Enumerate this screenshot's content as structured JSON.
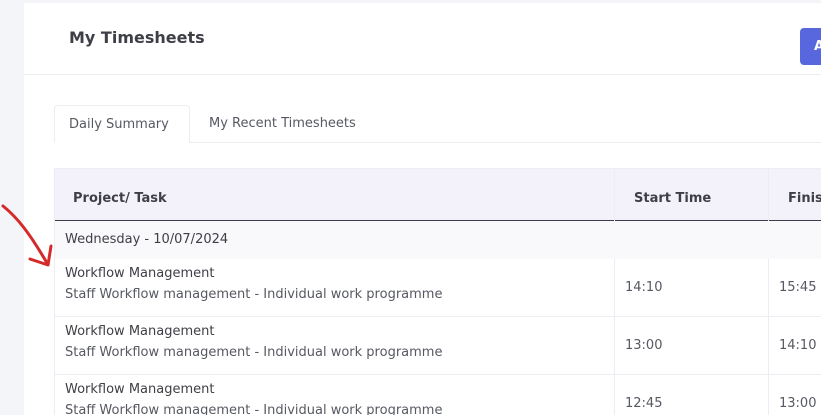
{
  "header": {
    "title": "My Timesheets",
    "add_button_label": "A"
  },
  "tabs": [
    {
      "label": "Daily Summary",
      "active": true
    },
    {
      "label": "My Recent Timesheets",
      "active": false
    }
  ],
  "table": {
    "columns": [
      "Project/ Task",
      "Start Time",
      "Finis"
    ],
    "groups": [
      {
        "day": "Wednesday - 10/07/2024",
        "rows": [
          {
            "project": "Workflow Management",
            "task": "Staff Workflow management - Individual work programme",
            "start": "14:10",
            "finish": "15:45"
          },
          {
            "project": "Workflow Management",
            "task": "Staff Workflow management - Individual work programme",
            "start": "13:00",
            "finish": "14:10"
          },
          {
            "project": "Workflow Management",
            "task": "Staff Workflow management - Individual work programme",
            "start": "12:45",
            "finish": "13:00"
          }
        ]
      }
    ]
  },
  "colors": {
    "accent": "#5867dd",
    "annotation_arrow": "#d42a2a"
  }
}
